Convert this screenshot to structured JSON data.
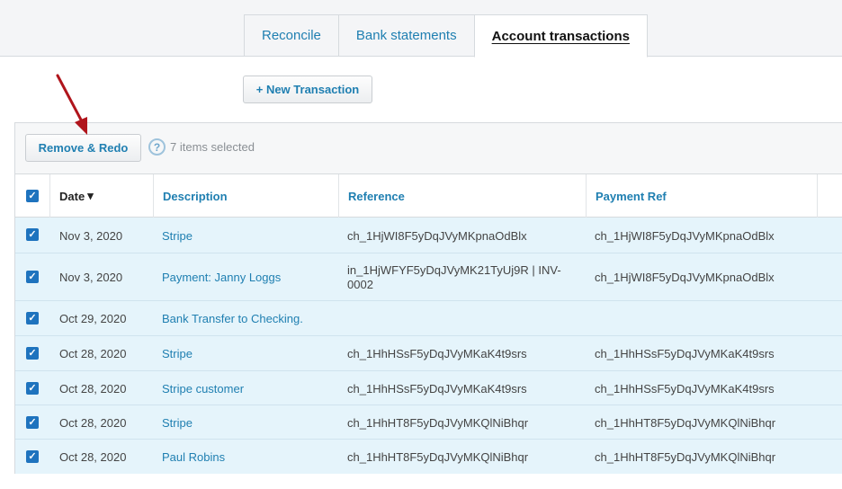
{
  "tabs": [
    {
      "label": "Reconcile"
    },
    {
      "label": "Bank statements"
    },
    {
      "label": "Account transactions"
    }
  ],
  "toolbar": {
    "new_transaction_label": "+ New Transaction",
    "remove_redo_label": "Remove & Redo",
    "help_glyph": "?",
    "selected_text": "7 items selected"
  },
  "table": {
    "headers": {
      "date": "Date",
      "date_sort_glyph": "▾",
      "description": "Description",
      "reference": "Reference",
      "payment_ref": "Payment Ref"
    },
    "rows": [
      {
        "date": "Nov 3, 2020",
        "description": "Stripe",
        "reference": "ch_1HjWI8F5yDqJVyMKpnaOdBlx",
        "payment_ref": "ch_1HjWI8F5yDqJVyMKpnaOdBlx"
      },
      {
        "date": "Nov 3, 2020",
        "description": "Payment: Janny Loggs",
        "reference": "in_1HjWFYF5yDqJVyMK21TyUj9R | INV-0002",
        "payment_ref": "ch_1HjWI8F5yDqJVyMKpnaOdBlx"
      },
      {
        "date": "Oct 29, 2020",
        "description": "Bank Transfer to Checking.",
        "reference": "",
        "payment_ref": ""
      },
      {
        "date": "Oct 28, 2020",
        "description": "Stripe",
        "reference": "ch_1HhHSsF5yDqJVyMKaK4t9srs",
        "payment_ref": "ch_1HhHSsF5yDqJVyMKaK4t9srs"
      },
      {
        "date": "Oct 28, 2020",
        "description": "Stripe customer",
        "reference": "ch_1HhHSsF5yDqJVyMKaK4t9srs",
        "payment_ref": "ch_1HhHSsF5yDqJVyMKaK4t9srs"
      },
      {
        "date": "Oct 28, 2020",
        "description": "Stripe",
        "reference": "ch_1HhHT8F5yDqJVyMKQlNiBhqr",
        "payment_ref": "ch_1HhHT8F5yDqJVyMKQlNiBhqr"
      },
      {
        "date": "Oct 28, 2020",
        "description": "Paul Robins",
        "reference": "ch_1HhHT8F5yDqJVyMKQlNiBhqr",
        "payment_ref": "ch_1HhHT8F5yDqJVyMKQlNiBhqr"
      }
    ]
  },
  "colors": {
    "accent": "#1f7fb1",
    "checkbox": "#1e73be",
    "selected_row": "#e5f4fb",
    "arrow": "#b0151c"
  },
  "icons": {
    "checkbox": "checkmark-icon",
    "help": "help-circle-icon",
    "annotation": "red-arrow-icon"
  }
}
